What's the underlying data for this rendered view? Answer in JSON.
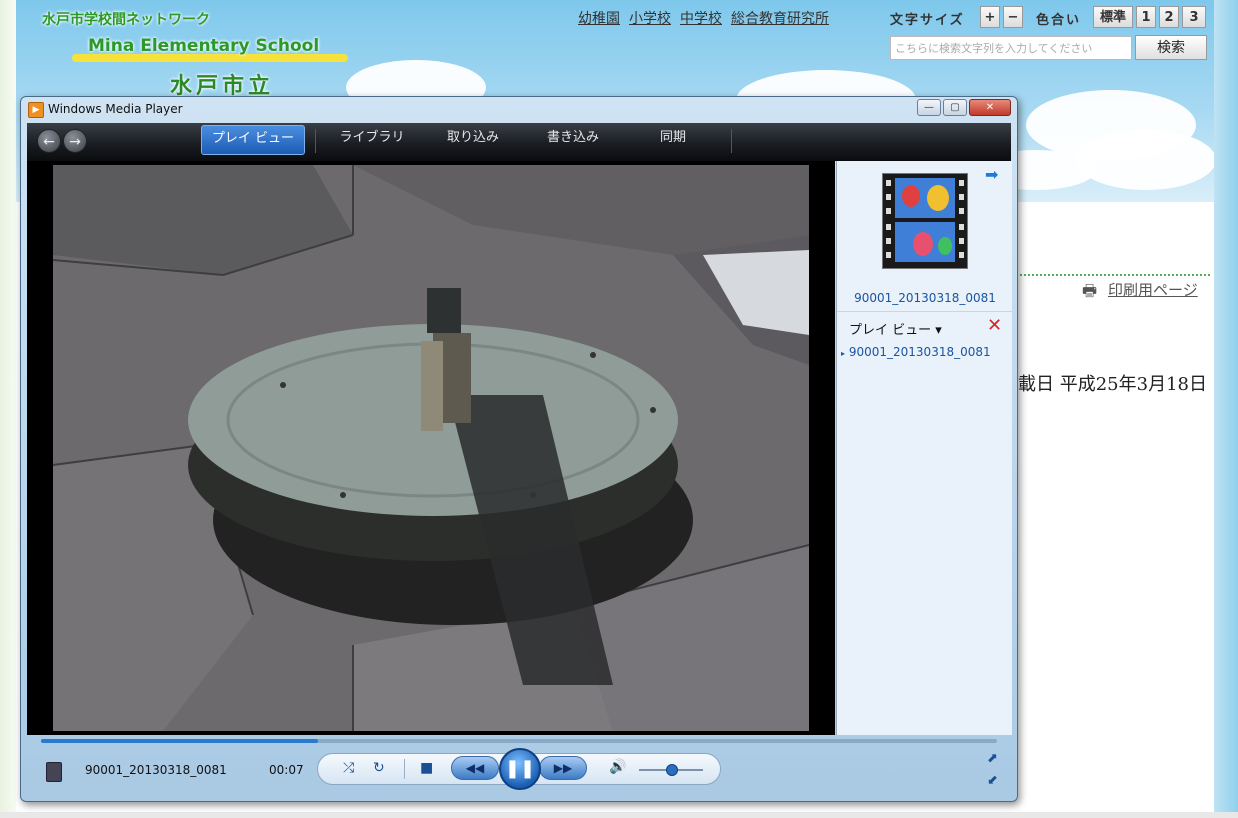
{
  "website": {
    "network_name": "水戸市学校間ネットワーク",
    "school_name_en": "Mina Elementary School",
    "school_name_jp": "水戸市立",
    "top_links": [
      "幼稚園",
      "小学校",
      "中学校",
      "総合教育研究所"
    ],
    "font_size_label": "文字サイズ",
    "font_plus": "+",
    "font_minus": "−",
    "color_label": "色合い",
    "color_options": [
      "標準",
      "1",
      "2",
      "3"
    ],
    "search_placeholder": "こちらに検索文字列を入力してください",
    "search_button": "検索",
    "print_link": "印刷用ページ",
    "date_text": "載日 平成25年3月18日"
  },
  "player": {
    "window_title": "Windows Media Player",
    "tabs": [
      "プレイ ビュー",
      "ライブラリ",
      "取り込み",
      "書き込み",
      "同期"
    ],
    "active_tab": "プレイ ビュー",
    "file_name": "90001_20130318_0081",
    "playlist_label": "プレイ ビュー",
    "playlist_items": [
      "90001_20130318_0081"
    ],
    "time": "00:07",
    "progress_fraction": 0.29,
    "volume_fraction": 0.5,
    "icons": {
      "back": "back-arrow-icon",
      "forward": "forward-arrow-icon",
      "shuffle": "shuffle-icon",
      "repeat": "repeat-icon",
      "stop": "stop-icon",
      "previous": "previous-icon",
      "pause": "pause-icon",
      "next": "next-icon",
      "volume": "speaker-icon"
    },
    "accent_color": "#1c5cb5"
  }
}
